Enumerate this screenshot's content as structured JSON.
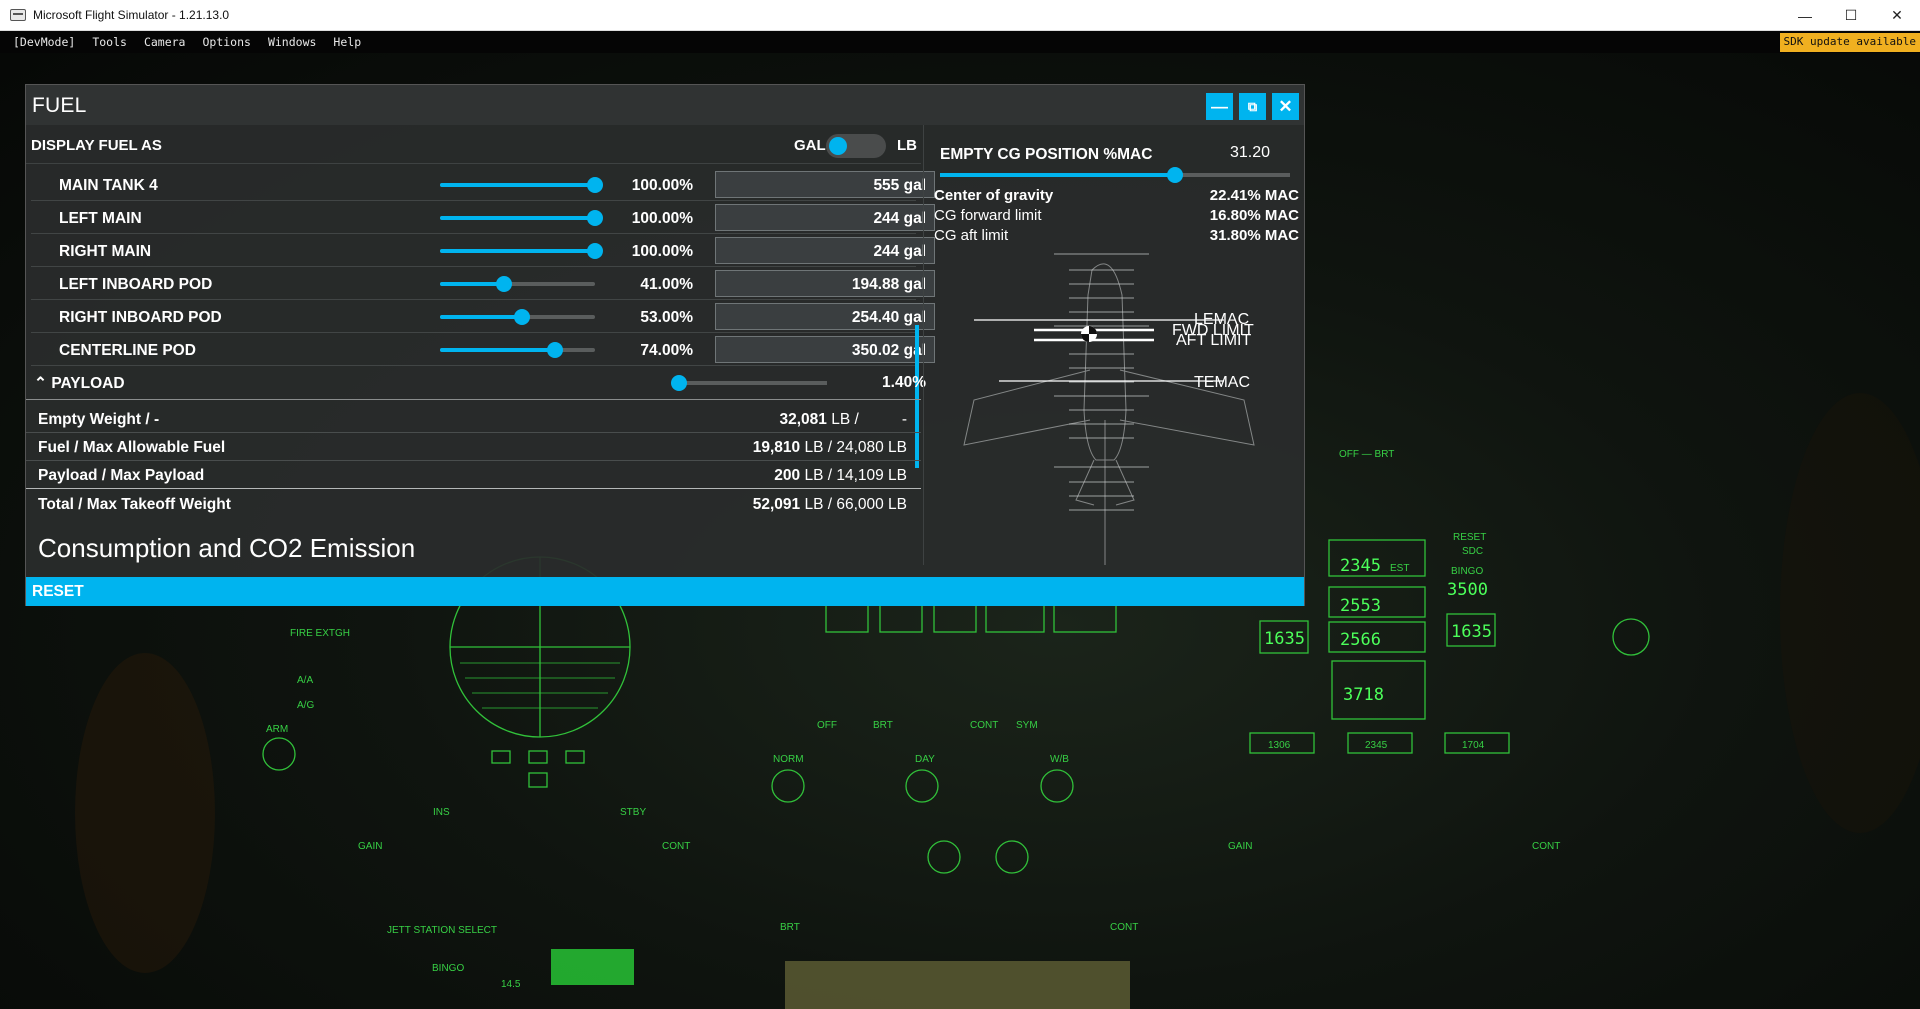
{
  "window": {
    "title": "Microsoft Flight Simulator - 1.21.13.0",
    "controls": {
      "minimize": "—",
      "maximize": "☐",
      "close": "✕"
    }
  },
  "devbar": {
    "menu": [
      "[DevMode]",
      "Tools",
      "Camera",
      "Options",
      "Windows",
      "Help"
    ],
    "sdk_notice": "SDK update available"
  },
  "fuel_panel": {
    "title": "FUEL",
    "display_fuel_as": {
      "label": "DISPLAY FUEL AS",
      "option_left": "GAL",
      "option_right": "LB",
      "selected": "GAL"
    },
    "tanks": [
      {
        "name": "MAIN TANK 4",
        "percent": "100.00%",
        "quantity": "555 gal",
        "level": 1.0
      },
      {
        "name": "LEFT MAIN",
        "percent": "100.00%",
        "quantity": "244 gal",
        "level": 1.0
      },
      {
        "name": "RIGHT MAIN",
        "percent": "100.00%",
        "quantity": "244 gal",
        "level": 1.0
      },
      {
        "name": "LEFT INBOARD POD",
        "percent": "41.00%",
        "quantity": "194.88 gal",
        "level": 0.41
      },
      {
        "name": "RIGHT INBOARD POD",
        "percent": "53.00%",
        "quantity": "254.40 gal",
        "level": 0.53
      },
      {
        "name": "CENTERLINE POD",
        "percent": "74.00%",
        "quantity": "350.02 gal",
        "level": 0.74
      }
    ],
    "payload": {
      "label": "PAYLOAD",
      "chevron": "^",
      "percent": "1.40%",
      "level": 0.014
    },
    "weights": [
      {
        "label": "Empty Weight / -",
        "value_bold": "32,081",
        "value_rest": " LB /          -"
      },
      {
        "label": "Fuel / Max Allowable Fuel",
        "value_bold": "19,810",
        "value_rest": " LB / 24,080 LB"
      },
      {
        "label": "Payload / Max Payload",
        "value_bold": "200",
        "value_rest": " LB / 14,109 LB"
      },
      {
        "label": "Total / Max Takeoff Weight",
        "value_bold": "52,091",
        "value_rest": " LB / 66,000 LB"
      }
    ],
    "consumption_heading": "Consumption and CO2 Emission",
    "reset_label": "RESET",
    "cg": {
      "empty_cg_label": "EMPTY CG POSITION %MAC",
      "empty_cg_value": "31.20",
      "stats": [
        {
          "label": "Center of gravity",
          "value": "22.41% MAC"
        },
        {
          "label": "CG forward limit",
          "value": "16.80% MAC"
        },
        {
          "label": "CG aft limit",
          "value": "31.80% MAC"
        }
      ],
      "diagram_labels": {
        "lemac": "LEMAC",
        "fwd_limit": "FWD LIMIT",
        "aft_limit": "AFT LIMIT",
        "temac": "TEMAC"
      }
    }
  },
  "cockpit": {
    "color_accent": "#37d045",
    "displays": {
      "tk1": "2345",
      "lfd": "2553",
      "rfd": "2566",
      "tk4": "3718",
      "lwg": "1635",
      "rwg": "1635",
      "bingo": "3500",
      "lext": "1306",
      "cl": "2345",
      "rext": "1704",
      "est": "EST",
      "bingo_label": "BINGO",
      "reset": "RESET",
      "sdc": "SDC"
    },
    "labels": {
      "off_brt": "OFF —        BRT",
      "fire_extgh": "FIRE EXTGH",
      "aa": "A/A",
      "ag": "A/G",
      "arm": "ARM",
      "gain": "GAIN",
      "cont": "CONT",
      "ins": "INS",
      "stby": "STBY",
      "brt": "BRT",
      "jett": "JETT STATION SELECT",
      "bingo_small": "BINGO"
    }
  }
}
